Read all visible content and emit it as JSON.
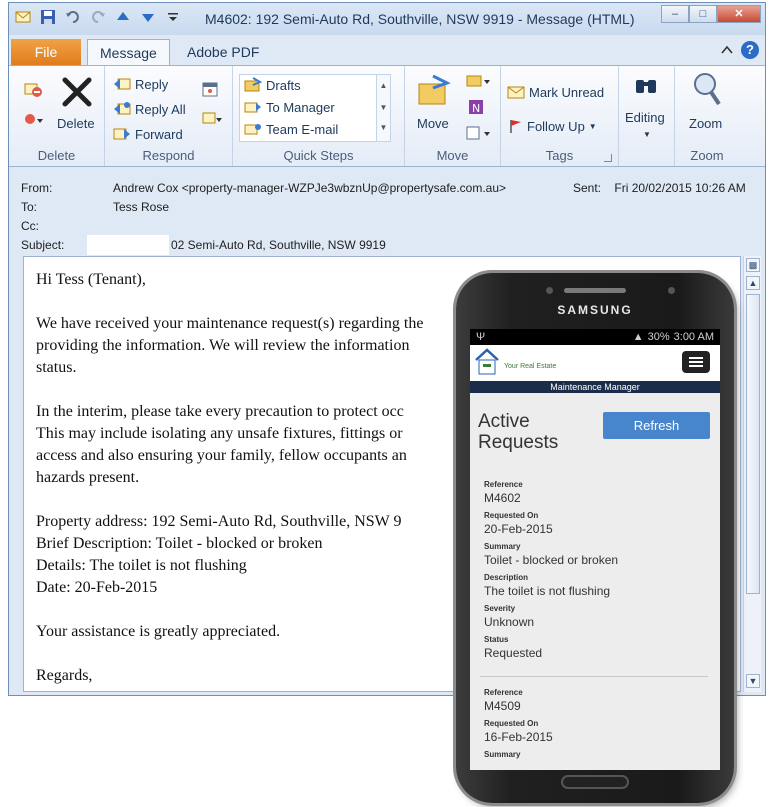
{
  "window": {
    "title": "M4602: 192 Semi-Auto Rd, Southville, NSW 9919  -  Message (HTML)"
  },
  "tabs": [
    {
      "label": "File"
    },
    {
      "label": "Message"
    },
    {
      "label": "Adobe PDF"
    }
  ],
  "ribbon": {
    "delete_group": {
      "label": "Delete",
      "delete": "Delete"
    },
    "respond_group": {
      "label": "Respond",
      "reply": "Reply",
      "reply_all": "Reply All",
      "forward": "Forward"
    },
    "quicksteps_group": {
      "label": "Quick Steps",
      "items": [
        "Drafts",
        "To Manager",
        "Team E-mail"
      ]
    },
    "move_group": {
      "label": "Move",
      "move": "Move"
    },
    "tags_group": {
      "label": "Tags",
      "mark_unread": "Mark Unread",
      "follow_up": "Follow Up"
    },
    "editing_group": {
      "editing": "Editing"
    },
    "zoom_group": {
      "label": "Zoom",
      "zoom": "Zoom"
    }
  },
  "header": {
    "from_label": "From:",
    "from_value": "Andrew Cox <property-manager-WZPJe3wbznUp@propertysafe.com.au>",
    "sent_label": "Sent:",
    "sent_value": "Fri 20/02/2015 10:26 AM",
    "to_label": "To:",
    "to_value": "Tess Rose",
    "cc_label": "Cc:",
    "subject_label": "Subject:",
    "subject_value": "02 Semi-Auto Rd, Southville, NSW 9919"
  },
  "message": {
    "greeting": "Hi Tess (Tenant),",
    "para1": "We have received your maintenance request(s) regarding the\nproviding the information. We will review the information\nstatus.",
    "para2": "In the interim, please take every precaution to protect occ\nThis may include isolating any unsafe fixtures, fittings or\naccess and also ensuring your family, fellow occupants an\nhazards present.",
    "details": "Property address: 192 Semi-Auto Rd, Southville, NSW 9\nBrief Description: Toilet - blocked or broken\nDetails: The toilet is not flushing\nDate: 20-Feb-2015",
    "closing": "Your assistance is greatly appreciated.",
    "signoff": "Regards,"
  },
  "phone": {
    "brand": "SAMSUNG",
    "status_time": "3:00 AM",
    "status_battery": "30%",
    "app_name": "Your Real Estate",
    "subtitle": "Maintenance Manager",
    "page_title": "Active Requests",
    "refresh_label": "Refresh",
    "requests": [
      {
        "reference_label": "Reference",
        "reference": "M4602",
        "requested_on_label": "Requested On",
        "requested_on": "20-Feb-2015",
        "summary_label": "Summary",
        "summary": "Toilet - blocked or broken",
        "description_label": "Description",
        "description": "The toilet is not flushing",
        "severity_label": "Severity",
        "severity": "Unknown",
        "status_label": "Status",
        "status": "Requested"
      },
      {
        "reference_label": "Reference",
        "reference": "M4509",
        "requested_on_label": "Requested On",
        "requested_on": "16-Feb-2015",
        "summary_label": "Summary"
      }
    ]
  },
  "colors": {
    "ribbon_accent": "#1e395b",
    "file_tab": "#e07c1c",
    "refresh_button": "#4786cc",
    "app_bar": "#1c2d49"
  }
}
